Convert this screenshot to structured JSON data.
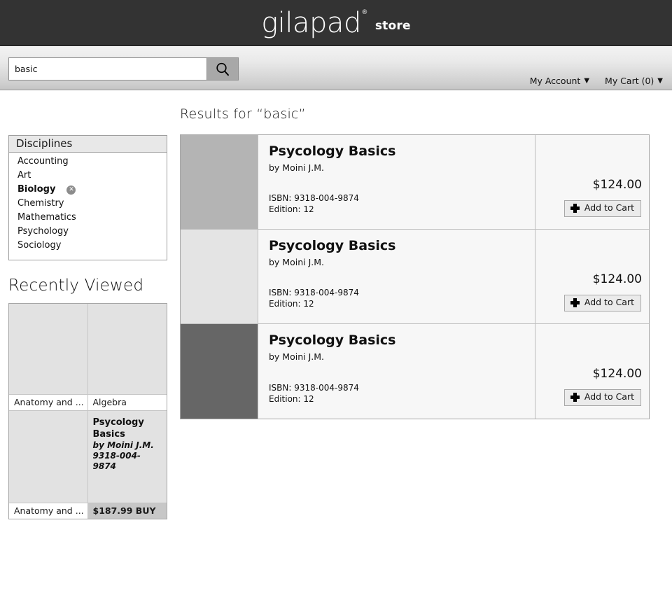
{
  "header": {
    "logo_name": "gilapad",
    "logo_registered": "®",
    "logo_suffix": "store"
  },
  "search": {
    "value": "basic",
    "placeholder": "Search",
    "button_icon": "search-icon"
  },
  "account": {
    "my_account_label": "My Account",
    "my_account_caret": "▼",
    "my_cart_label": "My Cart (0)",
    "my_cart_caret": "▼"
  },
  "facets": {
    "title": "Disciplines",
    "items": [
      {
        "label": "Accounting",
        "selected": false
      },
      {
        "label": "Art",
        "selected": false
      },
      {
        "label": "Biology",
        "selected": true,
        "remove_icon": "✕"
      },
      {
        "label": "Chemistry",
        "selected": false
      },
      {
        "label": "Mathematics",
        "selected": false
      },
      {
        "label": "Psychology",
        "selected": false
      },
      {
        "label": "Sociology",
        "selected": false
      }
    ]
  },
  "recently_viewed": {
    "heading": "Recently Viewed",
    "items": [
      {
        "label": "Anatomy and ...",
        "thumb_color": "#e2e2e2",
        "hovered": false
      },
      {
        "label": "Algebra",
        "thumb_color": "#e2e2e2",
        "hovered": false
      },
      {
        "label": "Anatomy and ...",
        "thumb_color": "#e2e2e2",
        "hovered": false
      },
      {
        "label": "$187.99 BUY",
        "thumb_color": "#e2e2e2",
        "hovered": true,
        "title": "Psycology Basics",
        "author": "by Moini J.M.",
        "isbn": "9318-004-9874",
        "price": "$187.99",
        "buy_label": "BUY"
      }
    ]
  },
  "results": {
    "heading": "Results for “basic”",
    "query": "basic",
    "rows": [
      {
        "title": "Psycology Basics",
        "author": "by Moini J.M.",
        "isbn_label": "ISBN: 9318-004-9874",
        "edition_label": "Edition: 12",
        "price": "$124.00",
        "cart_label": "Add to Cart",
        "thumb_color": "#b4b4b4"
      },
      {
        "title": "Psycology Basics",
        "author": "by Moini J.M.",
        "isbn_label": "ISBN: 9318-004-9874",
        "edition_label": "Edition: 12",
        "price": "$124.00",
        "cart_label": "Add to Cart",
        "thumb_color": "#e4e4e4"
      },
      {
        "title": "Psycology Basics",
        "author": "by Moini J.M.",
        "isbn_label": "ISBN: 9318-004-9874",
        "edition_label": "Edition: 12",
        "price": "$124.00",
        "cart_label": "Add to Cart",
        "thumb_color": "#666666"
      }
    ]
  },
  "colors": {
    "header_bg": "#333333",
    "page_bg": "#ffffff",
    "facet_head_bg": "#e8e8e8",
    "button_bg": "#ebebeb",
    "buy_bar_bg": "#c7c7c7",
    "search_btn_bg": "#a8a8a8"
  }
}
